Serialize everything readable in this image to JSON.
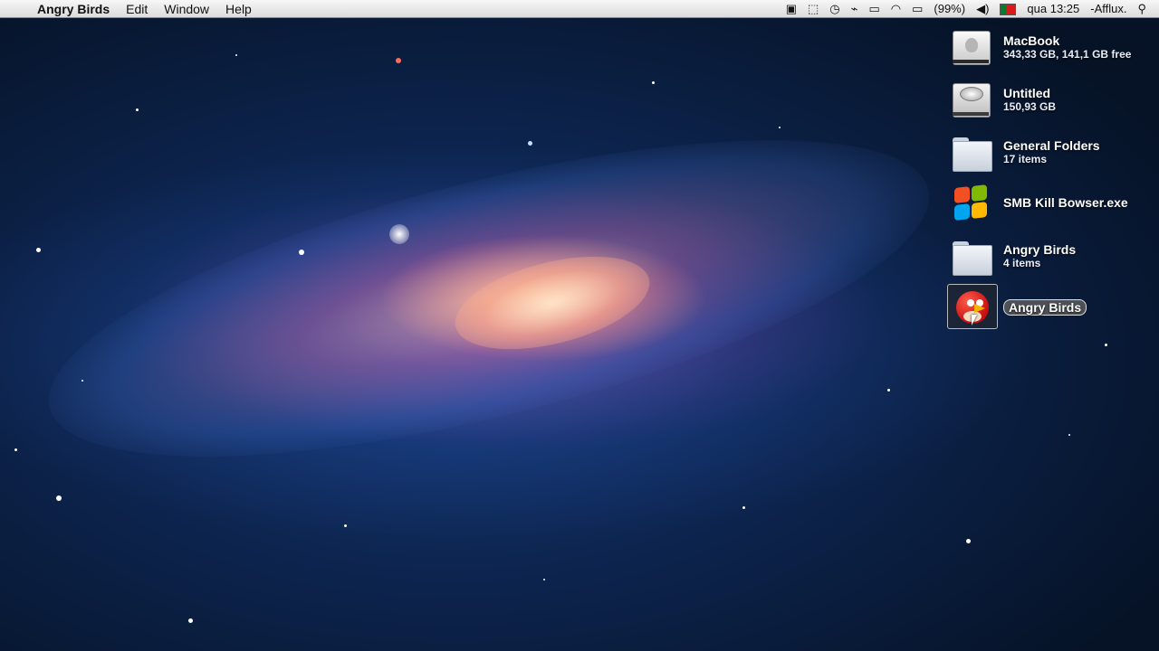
{
  "menubar": {
    "apple_glyph": "",
    "app_name": "Angry Birds",
    "menus": [
      "Edit",
      "Window",
      "Help"
    ],
    "status": {
      "battery_percent": "(99%)",
      "clock": "qua 13:25",
      "user": "-Afflux.",
      "icons": [
        "screen-recording-icon",
        "screenshot-icon",
        "time-machine-icon",
        "activity-icon",
        "display-icon",
        "wifi-icon",
        "battery-icon",
        "volume-icon",
        "portugal-flag-icon",
        "spotlight-search-icon"
      ]
    }
  },
  "desktop_icons": [
    {
      "name": "MacBook",
      "subtitle": "343,33 GB, 141,1 GB free",
      "icon": "macbook-drive-icon"
    },
    {
      "name": "Untitled",
      "subtitle": "150,93 GB",
      "icon": "hard-drive-icon"
    },
    {
      "name": "General Folders",
      "subtitle": "17 items",
      "icon": "folder-icon"
    },
    {
      "name": "SMB Kill Bowser.exe",
      "subtitle": "",
      "icon": "windows-exe-icon"
    },
    {
      "name": "Angry Birds",
      "subtitle": "4 items",
      "icon": "folder-icon"
    },
    {
      "name": "Angry Birds",
      "subtitle": "",
      "icon": "angry-birds-app-icon",
      "selected": true
    }
  ],
  "colors": {
    "wallpaper_dark": "#061327",
    "galaxy_core": "#ffd2b4",
    "menubar_bg": "#e8e8e8"
  }
}
